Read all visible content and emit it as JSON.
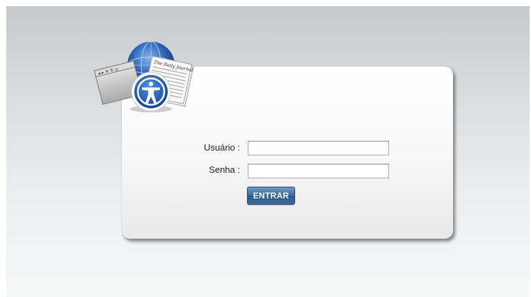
{
  "form": {
    "username_label": "Usuário :",
    "username_value": "",
    "password_label": "Senha :",
    "password_value": "",
    "submit_label": "ENTRAR"
  },
  "logo": {
    "icon": "accessibility-globe-icon",
    "newspaper_masthead": "The Daily Journal"
  },
  "colors": {
    "button": "#3c6d9f",
    "accessibility_blue": "#1f5fb8",
    "background_top": "#c6cacd"
  }
}
